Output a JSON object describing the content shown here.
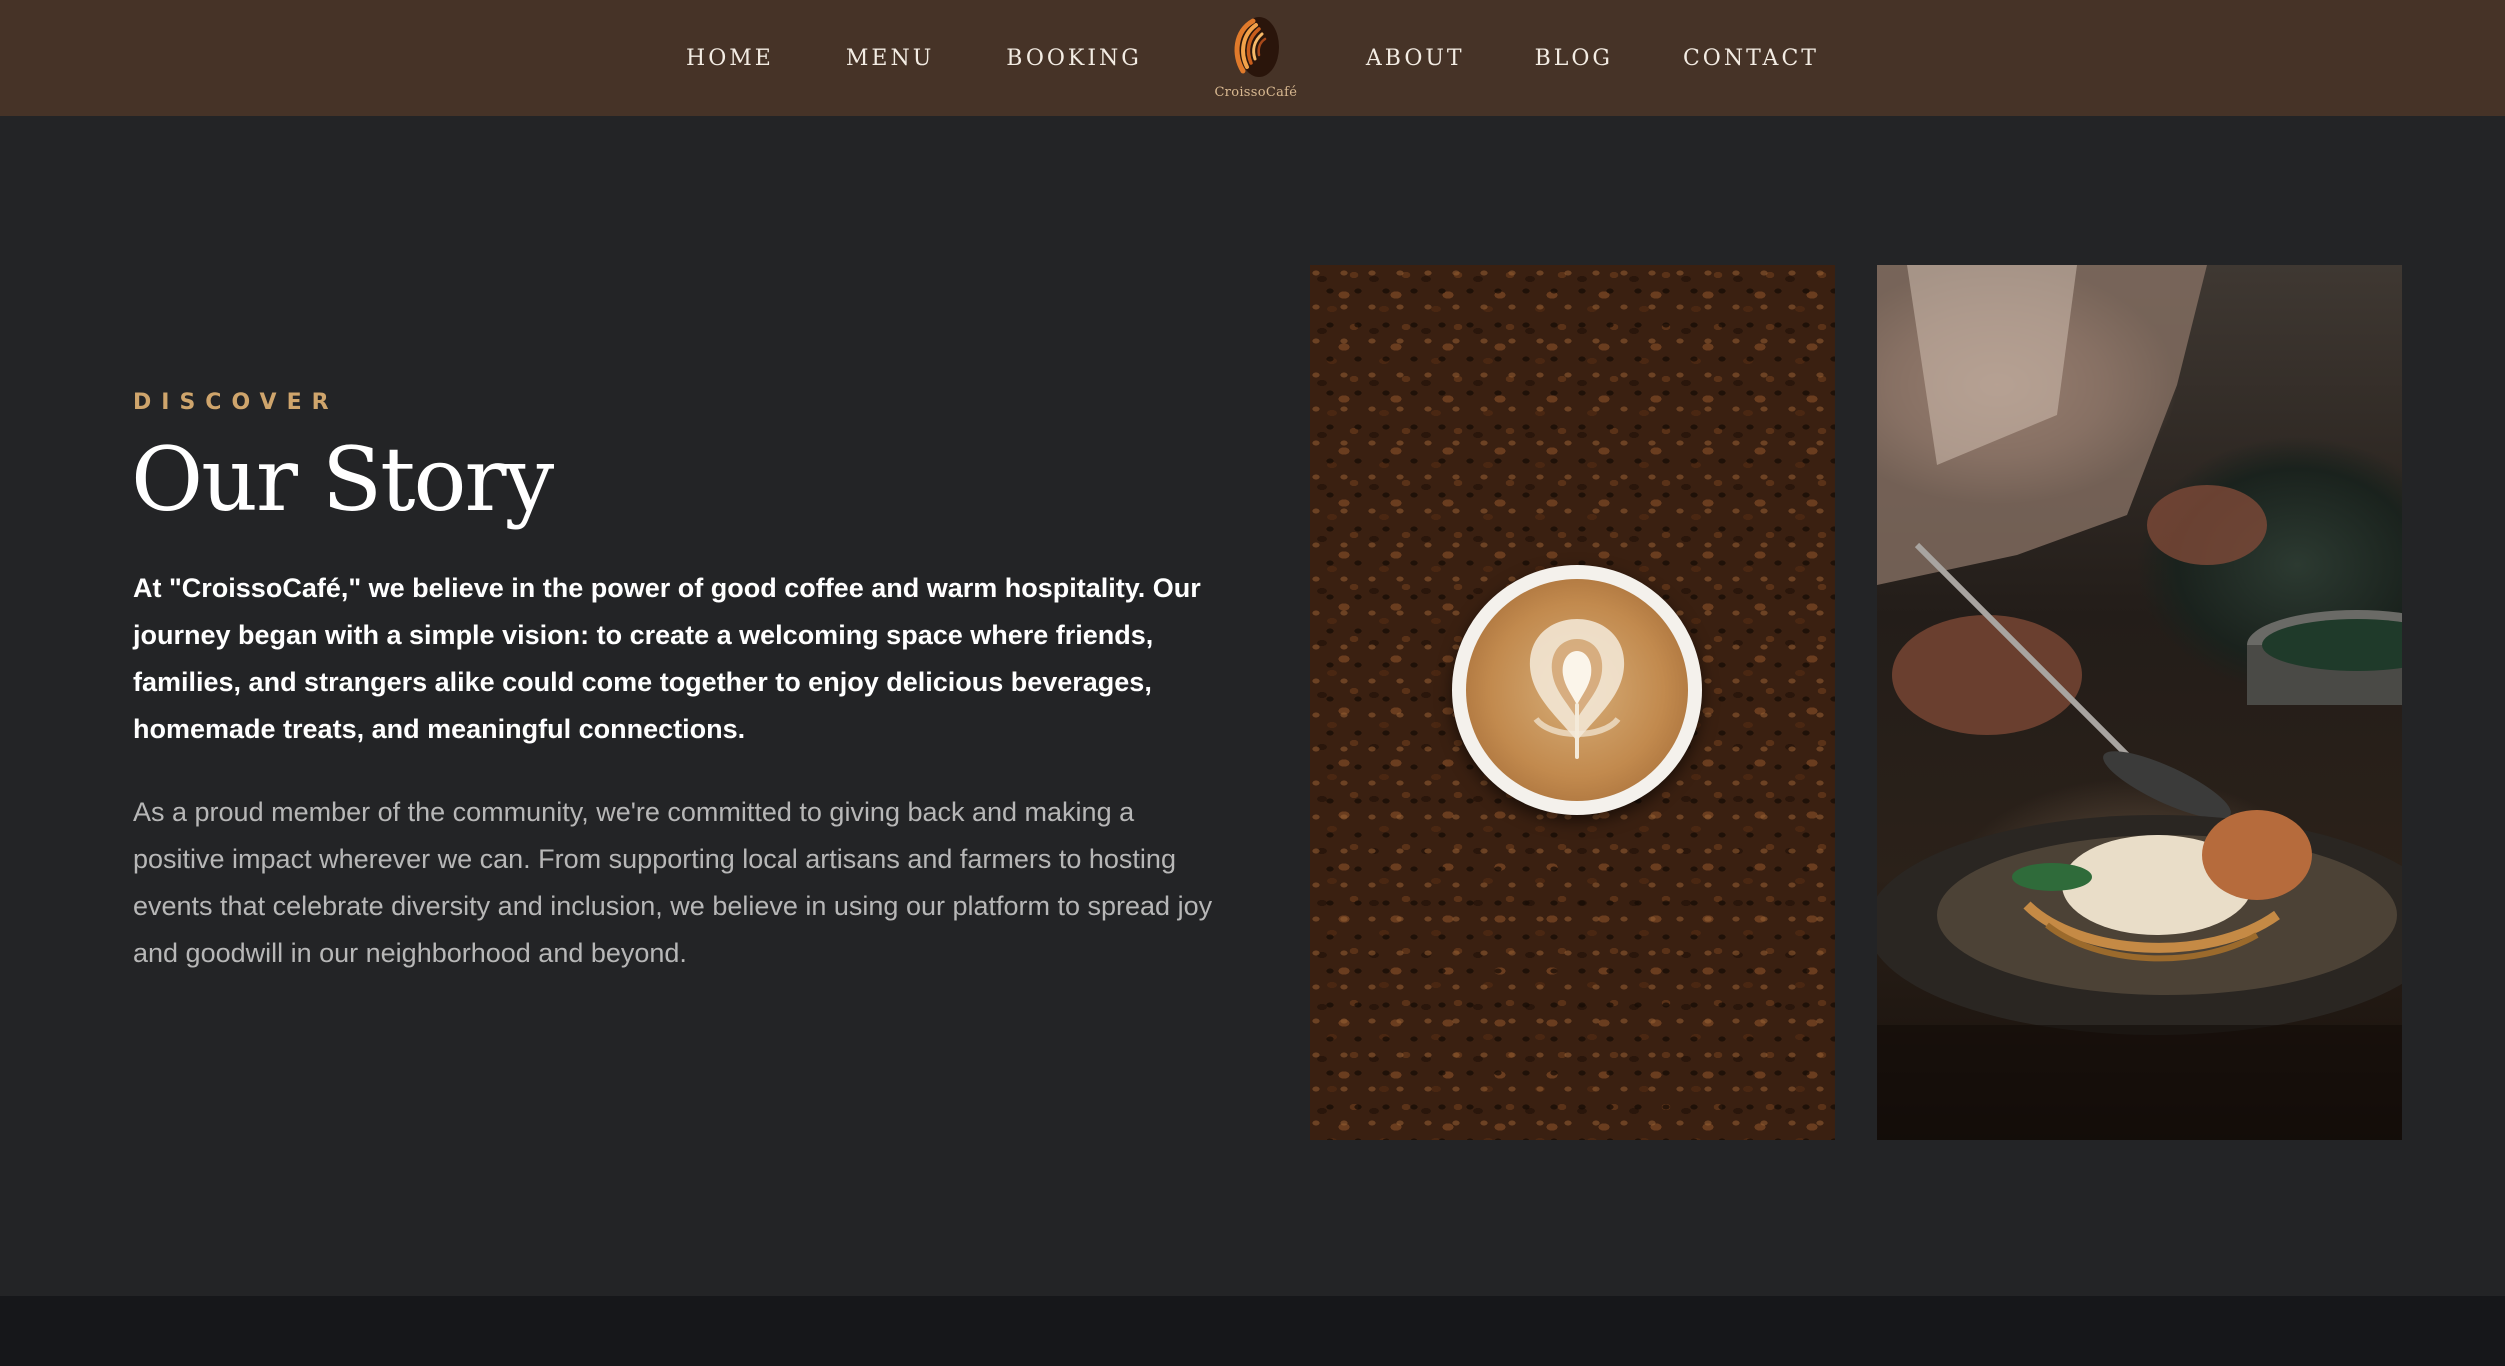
{
  "nav": {
    "left_links": [
      {
        "label": "HOME"
      },
      {
        "label": "MENU"
      },
      {
        "label": "BOOKING"
      }
    ],
    "right_links": [
      {
        "label": "ABOUT"
      },
      {
        "label": "BLOG"
      },
      {
        "label": "CONTACT"
      }
    ],
    "brand": {
      "name": "CroissoCafé",
      "icon": "croissant-logo-icon"
    }
  },
  "story": {
    "eyebrow": "DISCOVER",
    "title": "Our Story",
    "lead": "At \"CroissoCafé,\" we believe in the power of good coffee and warm hospitality. Our journey began with a simple vision: to create a welcoming space where friends, families, and strangers alike could come together to enjoy delicious beverages, homemade treats, and meaningful connections.",
    "body": "As a proud member of the community, we're committed to giving back and making a positive impact wherever we can. From supporting local artisans and farmers to hosting events that celebrate diversity and inclusion, we believe in using our platform to spread joy and goodwill in our neighborhood and beyond."
  },
  "photos": [
    {
      "subject": "latte-art-cup-on-coffee-beans"
    },
    {
      "subject": "chef-plating-dish"
    }
  ],
  "colors": {
    "nav_bg": "#463327",
    "page_bg": "#232426",
    "accent": "#cfa56c",
    "footer_bg": "#16171a"
  }
}
